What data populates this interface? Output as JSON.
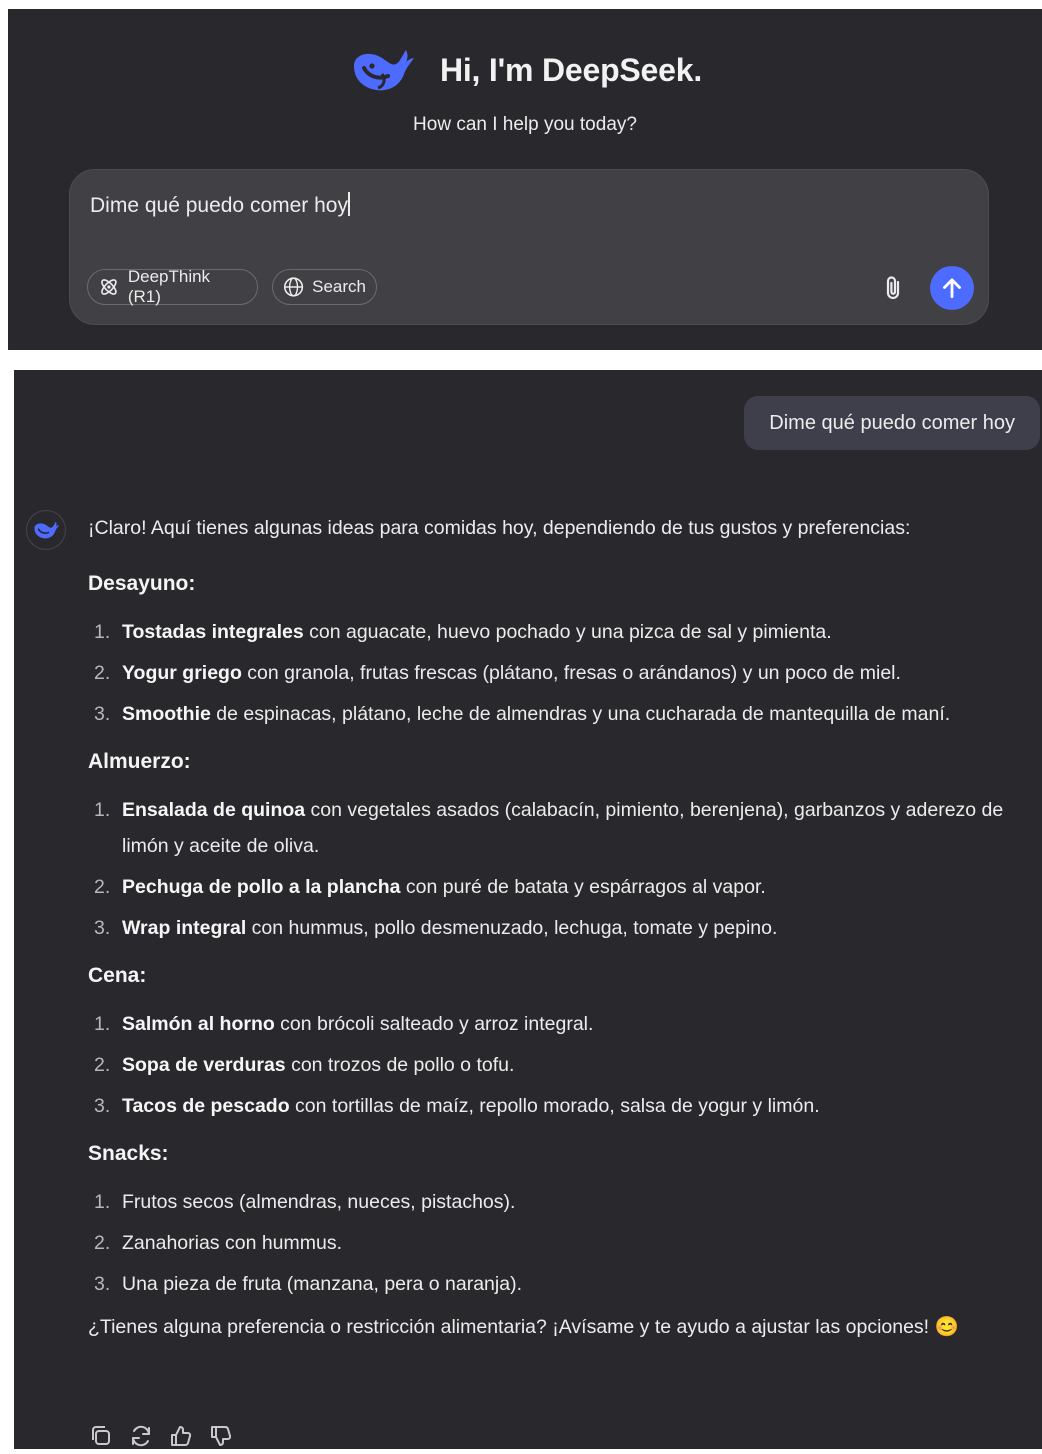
{
  "home": {
    "title": "Hi, I'm DeepSeek.",
    "subtitle": "How can I help you today?",
    "input_value": "Dime qué puedo comer hoy",
    "deepthink_label": "DeepThink (R1)",
    "search_label": "Search"
  },
  "chat": {
    "user_message": "Dime qué puedo comer hoy",
    "intro": "¡Claro! Aquí tienes algunas ideas para comidas hoy, dependiendo de tus gustos y preferencias:",
    "sections": [
      {
        "heading": "Desayuno:",
        "items": [
          {
            "num": "1.",
            "bold": "Tostadas integrales",
            "text": " con aguacate, huevo pochado y una pizca de sal y pimienta."
          },
          {
            "num": "2.",
            "bold": "Yogur griego",
            "text": " con granola, frutas frescas (plátano, fresas o arándanos) y un poco de miel."
          },
          {
            "num": "3.",
            "bold": "Smoothie",
            "text": " de espinacas, plátano, leche de almendras y una cucharada de mantequilla de maní."
          }
        ]
      },
      {
        "heading": "Almuerzo:",
        "items": [
          {
            "num": "1.",
            "bold": "Ensalada de quinoa",
            "text": " con vegetales asados (calabacín, pimiento, berenjena), garbanzos y aderezo de limón y aceite de oliva."
          },
          {
            "num": "2.",
            "bold": "Pechuga de pollo a la plancha",
            "text": " con puré de batata y espárragos al vapor."
          },
          {
            "num": "3.",
            "bold": "Wrap integral",
            "text": " con hummus, pollo desmenuzado, lechuga, tomate y pepino."
          }
        ]
      },
      {
        "heading": "Cena:",
        "items": [
          {
            "num": "1.",
            "bold": "Salmón al horno",
            "text": " con brócoli salteado y arroz integral."
          },
          {
            "num": "2.",
            "bold": "Sopa de verduras",
            "text": " con trozos de pollo o tofu."
          },
          {
            "num": "3.",
            "bold": "Tacos de pescado",
            "text": " con tortillas de maíz, repollo morado, salsa de yogur y limón."
          }
        ]
      },
      {
        "heading": "Snacks:",
        "items": [
          {
            "num": "1.",
            "bold": "",
            "text": "Frutos secos (almendras, nueces, pistachos)."
          },
          {
            "num": "2.",
            "bold": "",
            "text": "Zanahorias con hummus."
          },
          {
            "num": "3.",
            "bold": "",
            "text": "Una pieza de fruta (manzana, pera o naranja)."
          }
        ]
      }
    ],
    "closing": "¿Tienes alguna preferencia o restricción alimentaria? ¡Avísame y te ayudo a ajustar las opciones! 😊"
  },
  "icons": {
    "logo": "deepseek-whale-icon",
    "deepthink": "atom-icon",
    "search": "globe-icon",
    "attach": "paperclip-icon",
    "send": "arrow-up-icon",
    "copy": "copy-icon",
    "regenerate": "refresh-icon",
    "like": "thumbs-up-icon",
    "dislike": "thumbs-down-icon"
  },
  "colors": {
    "background": "#29292d",
    "input": "#404045",
    "user_bubble": "#3e3f4b",
    "accent": "#4d6bfe",
    "text": "#ececec"
  }
}
